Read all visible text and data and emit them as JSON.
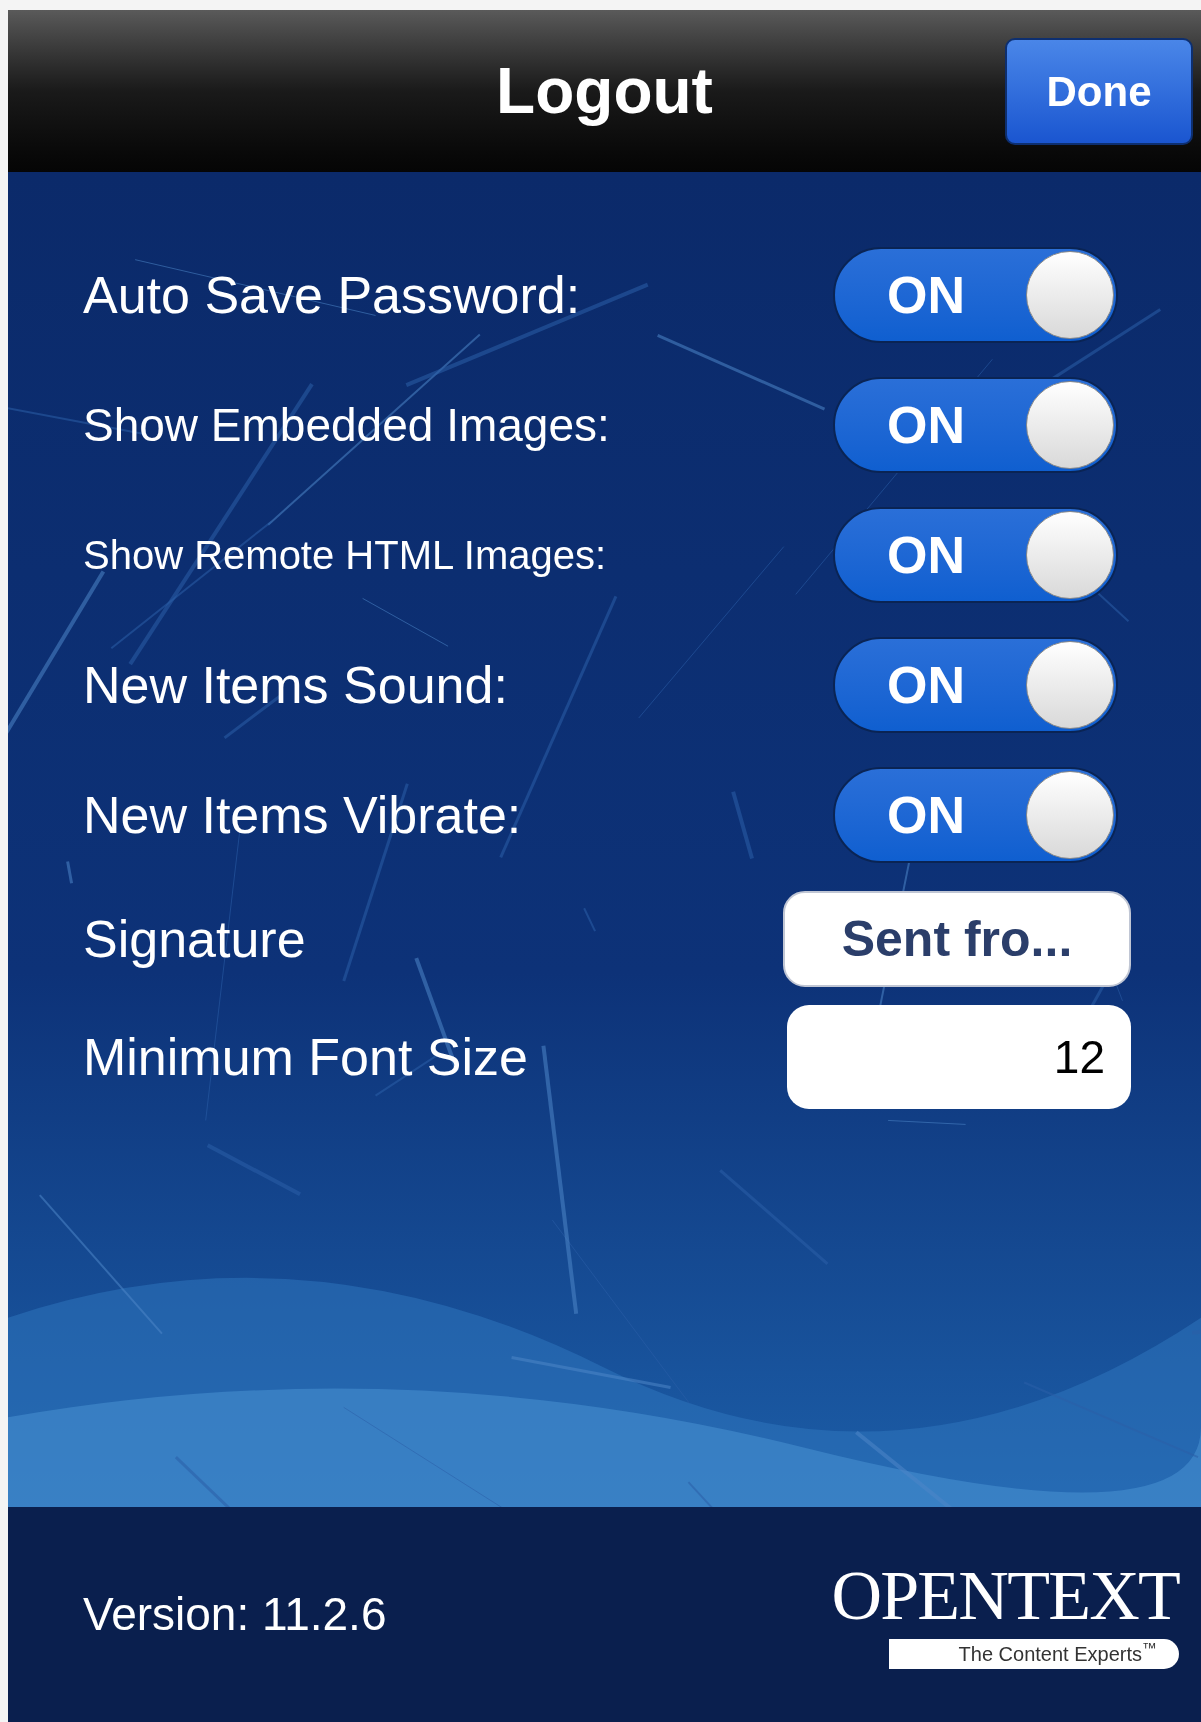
{
  "nav_bar": {
    "title": "Logout",
    "done_button": "Done"
  },
  "settings": [
    {
      "kind": "toggle",
      "label": "Auto Save Password:",
      "value": "ON",
      "on": true
    },
    {
      "kind": "toggle",
      "label": "Show Embedded Images:",
      "value": "ON",
      "on": true
    },
    {
      "kind": "toggle",
      "label": "Show Remote HTML Images:",
      "value": "ON",
      "on": true
    },
    {
      "kind": "toggle",
      "label": "New Items Sound:",
      "value": "ON",
      "on": true
    },
    {
      "kind": "toggle",
      "label": "New Items Vibrate:",
      "value": "ON",
      "on": true
    },
    {
      "kind": "button",
      "label": "Signature",
      "value": "Sent fro..."
    },
    {
      "kind": "field",
      "label": "Minimum Font Size",
      "value": "12"
    }
  ],
  "footer": {
    "version": "Version: 11.2.6",
    "logo": {
      "name": "OPENTEXT",
      "tagline": "The Content Experts$^{™}$"
    }
  }
}
